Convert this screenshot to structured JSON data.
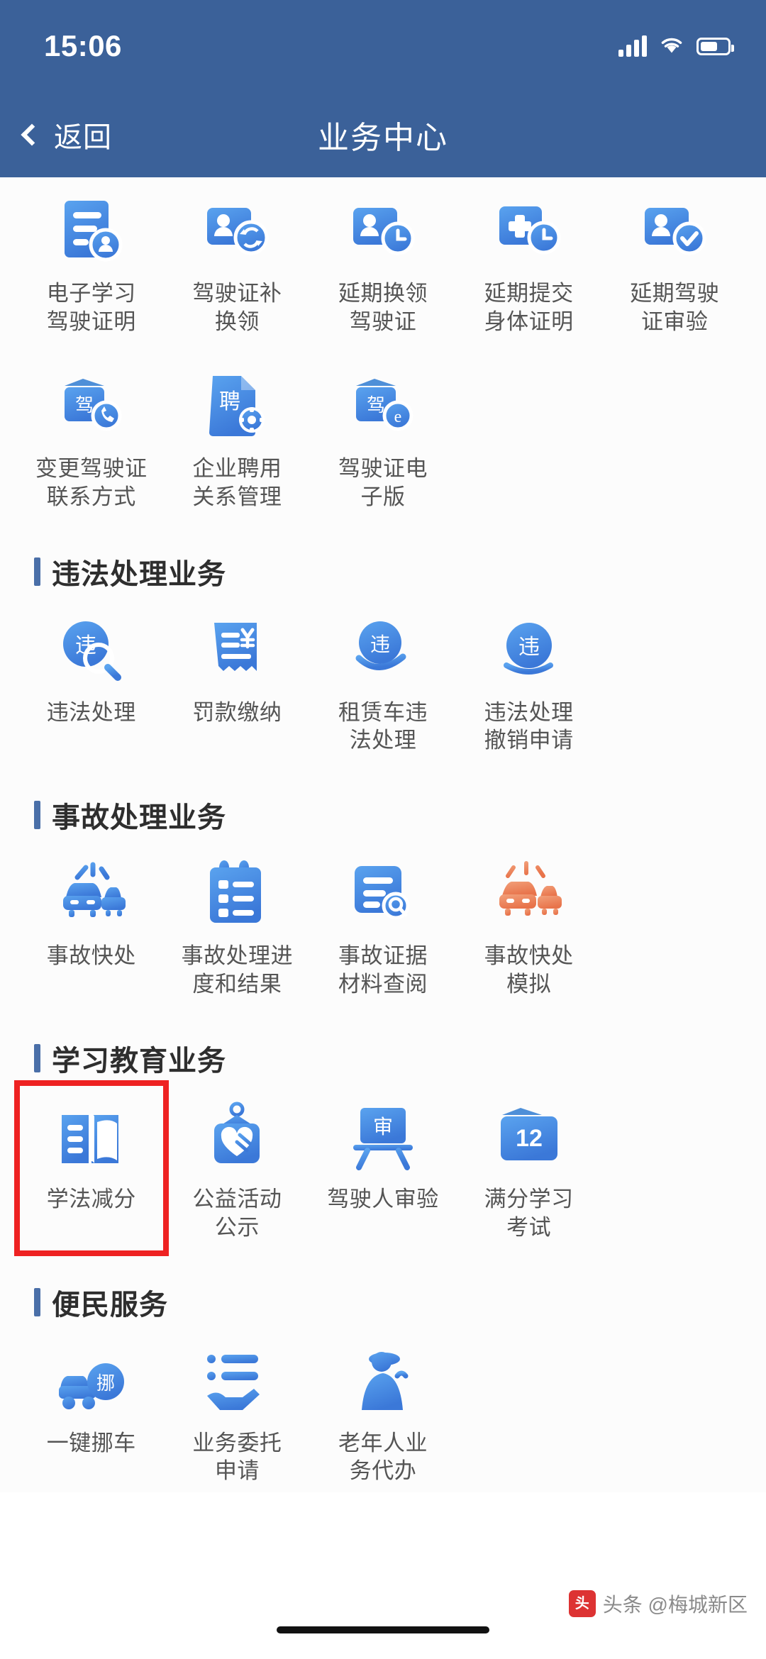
{
  "status_bar": {
    "time": "15:06",
    "signal_icon": "cellular-signal-icon",
    "wifi_icon": "wifi-icon",
    "battery_icon": "battery-icon"
  },
  "nav": {
    "back_label": "返回",
    "back_icon": "chevron-left-icon",
    "title": "业务中心"
  },
  "theme": {
    "header_blue": "#3b6199",
    "icon_blue": "#4a90e2",
    "icon_blue_dark": "#3573d4",
    "accent_orange": "#ef7b45",
    "highlight_red": "#ee2222",
    "section_bar": "#4a6fa8",
    "label_gray": "#555555"
  },
  "sections": [
    {
      "title": "",
      "show_header": false,
      "items": [
        {
          "label": "电子学习\n驾驶证明",
          "icon": "doc-person-icon"
        },
        {
          "label": "驾驶证补\n换领",
          "icon": "id-card-refresh-icon"
        },
        {
          "label": "延期换领\n驾驶证",
          "icon": "id-card-clock-icon"
        },
        {
          "label": "延期提交\n身体证明",
          "icon": "medical-clock-icon"
        },
        {
          "label": "延期驾驶\n证审验",
          "icon": "id-card-check-icon"
        },
        {
          "label": "变更驾驶证\n联系方式",
          "icon": "license-phone-icon"
        },
        {
          "label": "企业聘用\n关系管理",
          "icon": "employment-gear-icon"
        },
        {
          "label": "驾驶证电\n子版",
          "icon": "license-electronic-icon"
        }
      ]
    },
    {
      "title": "违法处理业务",
      "show_header": true,
      "items": [
        {
          "label": "违法处理",
          "icon": "violation-search-icon"
        },
        {
          "label": "罚款缴纳",
          "icon": "fine-receipt-icon"
        },
        {
          "label": "租赁车违\n法处理",
          "icon": "rental-violation-icon"
        },
        {
          "label": "违法处理\n撤销申请",
          "icon": "violation-revoke-icon"
        }
      ]
    },
    {
      "title": "事故处理业务",
      "show_header": true,
      "items": [
        {
          "label": "事故快处",
          "icon": "crash-cars-icon"
        },
        {
          "label": "事故处理进\n度和结果",
          "icon": "clipboard-progress-icon"
        },
        {
          "label": "事故证据\n材料查阅",
          "icon": "doc-search-icon"
        },
        {
          "label": "事故快处\n模拟",
          "icon": "crash-simulation-icon"
        }
      ]
    },
    {
      "title": "学习教育业务",
      "show_header": true,
      "items": [
        {
          "label": "学法减分",
          "icon": "open-book-icon",
          "highlighted": true
        },
        {
          "label": "公益活动\n公示",
          "icon": "charity-heart-icon"
        },
        {
          "label": "驾驶人审验",
          "icon": "exam-board-icon"
        },
        {
          "label": "满分学习\n考试",
          "icon": "twelve-points-icon",
          "badge": "12"
        }
      ]
    },
    {
      "title": "便民服务",
      "show_header": true,
      "items": [
        {
          "label": "一键挪车",
          "icon": "move-car-icon",
          "badge": "挪"
        },
        {
          "label": "业务委托\n申请",
          "icon": "delegate-hand-icon"
        },
        {
          "label": "老年人业\n务代办",
          "icon": "elderly-service-icon"
        }
      ]
    }
  ],
  "footer": {
    "watermark_logo": "头条",
    "watermark_text": "头条 @梅城新区",
    "home_indicator": "home-indicator"
  }
}
